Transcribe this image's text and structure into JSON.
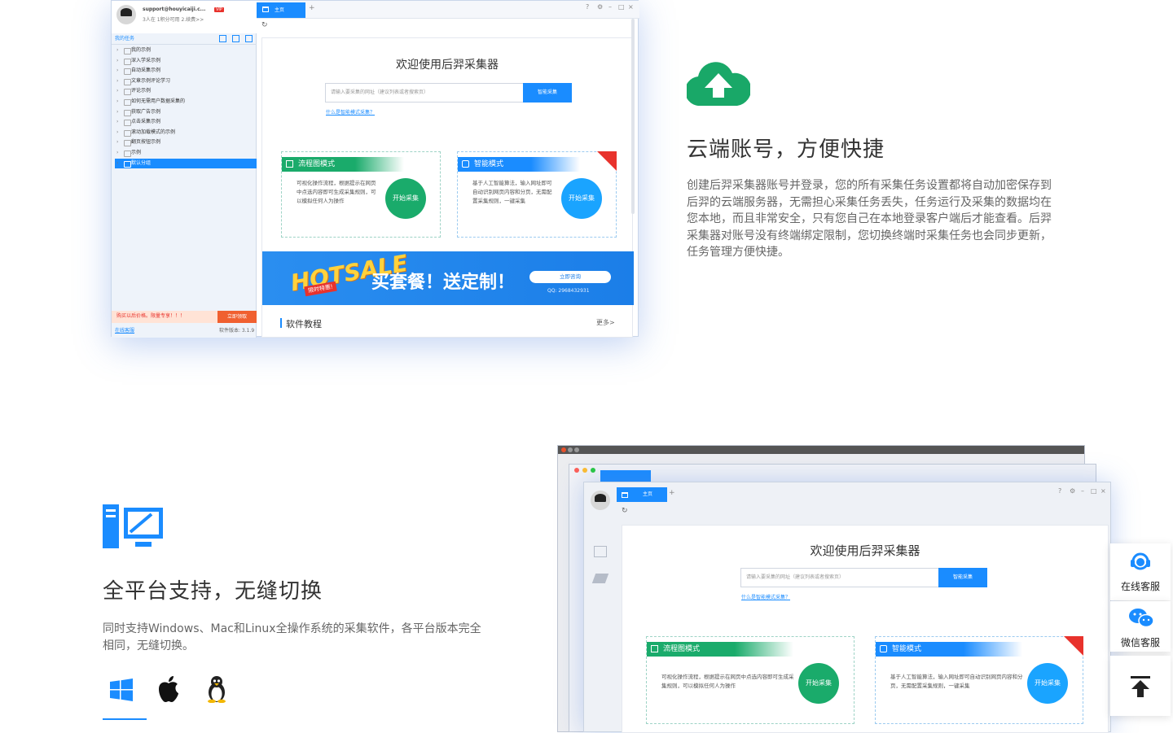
{
  "app_top": {
    "email": "support@houyicaiji.c...",
    "vip_badge": "VIP",
    "subline": "3人在 1积分可用  2.续费>>",
    "section_label": "我的任务",
    "tree": [
      "我的示例",
      "深入学采示例",
      "自动采集示例",
      "文章示例评论学习",
      "评论示例",
      "如何无需用户数据采集的",
      "获取广告示例",
      "点击采集示例",
      "滚动加载模式的示例",
      "翻页按钮示例",
      "示例",
      "默认分组"
    ],
    "tab_home": "主页",
    "tab_add": "+",
    "welcome": "欢迎使用后羿采集器",
    "search_placeholder": "请输入要采集的网址（建议列表或者搜索页）",
    "search_button": "智能采集",
    "help_link": "什么是智能模式采集？",
    "mode1_title": "流程图模式",
    "mode1_desc": "可视化操作流程，根据提示在网页中点选内容即可生成采集规则，可以模拟任何人为操作",
    "mode1_button": "开始采集",
    "mode2_title": "智能模式",
    "mode2_desc": "基于人工智能算法，输入网址即可自动识别网页内容和分页，无需配置采集规则，一键采集",
    "mode2_button": "开始采集",
    "banner_hot": "HOTSALE",
    "banner_ribbon": "限时特惠!",
    "banner_title": "买套餐！送定制！",
    "banner_btn": "立即咨询",
    "banner_qq": "QQ: 2968432931",
    "tutorial": "软件教程",
    "more": "更多>",
    "notice": "购买以后价格。限量专享！！！",
    "notice_btn": "立即领取",
    "footer_left": "在线客服",
    "footer_version": "软件版本: 3.1.9"
  },
  "cloud_section": {
    "title": "云端账号，方便快捷",
    "body": "创建后羿采集器账号并登录，您的所有采集任务设置都将自动加密保存到后羿的云端服务器，无需担心采集任务丢失，任务运行及采集的数据均在您本地，而且非常安全，只有您自己在本地登录客户端后才能查看。后羿采集器对账号没有终端绑定限制，您切换终端时采集任务也会同步更新，任务管理方便快捷。"
  },
  "platform_section": {
    "title": "全平台支持，无缝切换",
    "body": "同时支持Windows、Mac和Linux全操作系统的采集软件，各平台版本完全相同，无缝切换。",
    "platforms": [
      "windows-icon",
      "apple-icon",
      "linux-icon"
    ]
  },
  "app_stack": {
    "tab_home": "主页",
    "tab_add": "+",
    "welcome": "欢迎使用后羿采集器",
    "search_placeholder": "请输入要采集的网址（建议列表或者搜索页）",
    "search_button": "智能采集",
    "help_link": "什么是智能模式采集？",
    "mode1_title": "流程图模式",
    "mode1_desc": "可视化操作流程，根据提示在网页中点选内容即可生成采集规则，可以模拟任何人为操作",
    "mode1_button": "开始采集",
    "mode2_title": "智能模式",
    "mode2_desc": "基于人工智能算法，输入网址即可自动识别网页内容和分页，无需配置采集规则，一键采集",
    "mode2_button": "开始采集"
  },
  "float_bar": {
    "online_service": "在线客服",
    "wechat_service": "微信客服"
  },
  "colors": {
    "brand_blue": "#1a8cff",
    "green": "#1aab6b",
    "cloud_green": "#19a868",
    "platform_blue": "#1a8cff"
  }
}
